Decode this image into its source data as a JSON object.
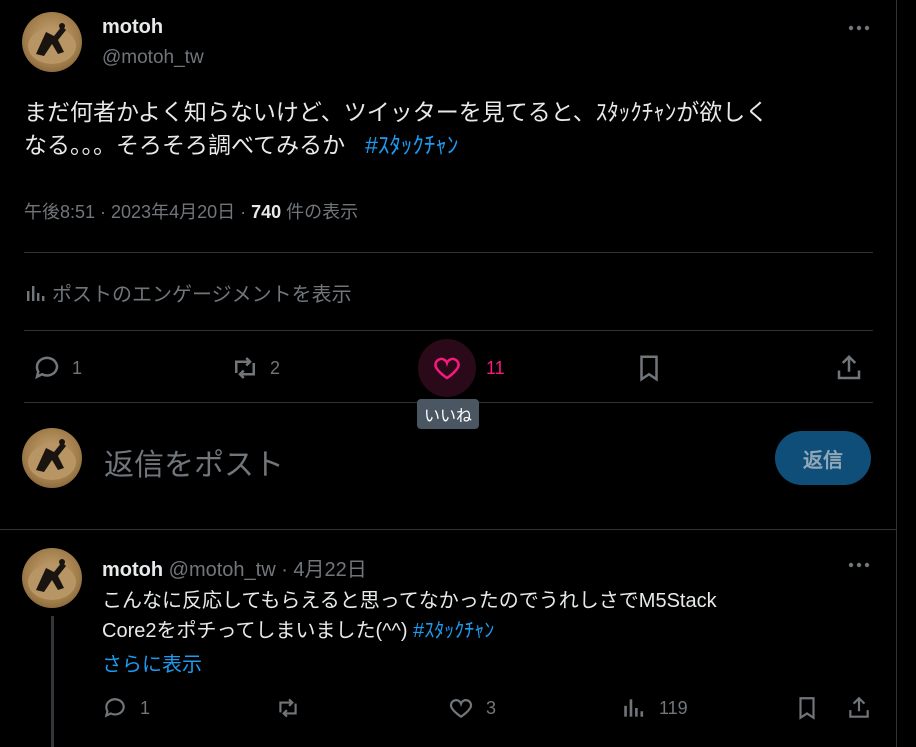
{
  "main_tweet": {
    "display_name": "motoh",
    "handle": "@motoh_tw",
    "text_line1": "まだ何者かよく知らないけど、ツイッターを見てると、ｽﾀｯｸﾁｬﾝが欲しく",
    "text_line2": "なる。。。そろそろ調べてみるか",
    "hashtag": "#ｽﾀｯｸﾁｬﾝ",
    "time": "午後8:51 · 2023年4月20日 · ",
    "views_count": "740",
    "views_label": " 件の表示",
    "engagement_label": "ポストのエンゲージメントを表示",
    "reply_count": "1",
    "retweet_count": "2",
    "like_count": "11",
    "like_tooltip": "いいね"
  },
  "composer": {
    "placeholder": "返信をポスト",
    "button_label": "返信"
  },
  "reply_tweet": {
    "display_name": "motoh",
    "handle_date": " @motoh_tw · 4月22日",
    "text_line1": "こんなに反応してもらえると思ってなかったのでうれしさでM5Stack",
    "text_line2": "Core2をポチってしまいました(^^) ",
    "hashtag": "#ｽﾀｯｸﾁｬﾝ",
    "show_more": "さらに表示",
    "reply_count": "1",
    "like_count": "3",
    "views_count": "119"
  },
  "colors": {
    "background": "#000000",
    "accent": "#1d9bf0",
    "like": "#f91880",
    "muted": "#71767b"
  }
}
